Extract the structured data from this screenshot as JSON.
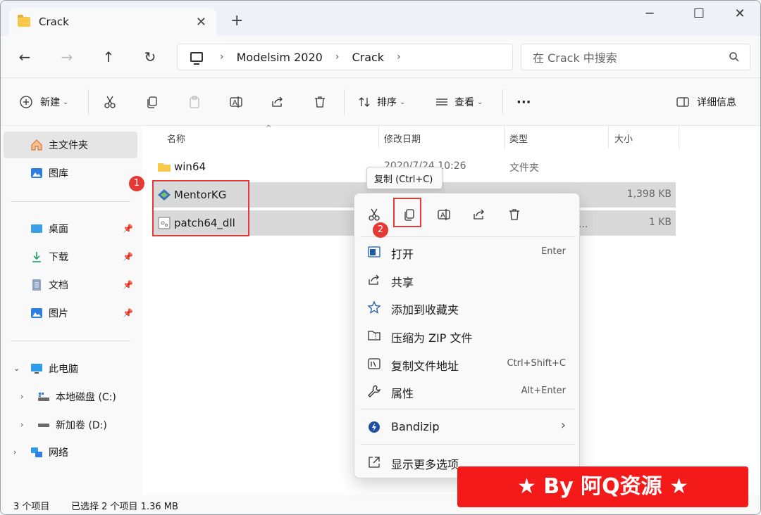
{
  "window": {
    "tab_title": "Crack",
    "tab_close": "✕",
    "new_tab": "+",
    "minimize": "─",
    "maximize": "☐",
    "close": "✕"
  },
  "addressbar": {
    "back": "←",
    "forward": "→",
    "up": "↑",
    "refresh": "↻",
    "crumbs": [
      "Modelsim 2020",
      "Crack"
    ],
    "sep": "›",
    "search_placeholder": "在 Crack 中搜索"
  },
  "toolbar": {
    "new_label": "新建",
    "sort_label": "排序",
    "view_label": "查看",
    "more": "···",
    "details_label": "详细信息",
    "dropdown": "⌄"
  },
  "sidebar": {
    "home": "主文件夹",
    "gallery": "图库",
    "desktop": "桌面",
    "downloads": "下载",
    "documents": "文档",
    "pictures": "图片",
    "this_pc": "此电脑",
    "drive_c": "本地磁盘 (C:)",
    "drive_d": "新加卷 (D:)",
    "network": "网络",
    "pin": "📌",
    "expanded": "⌄",
    "collapsed": "›"
  },
  "columns": {
    "name": "名称",
    "modified": "修改日期",
    "type": "类型",
    "size": "大小",
    "sort_arrow": "^"
  },
  "files": [
    {
      "name": "win64",
      "modified": "2020/7/24 10:26",
      "type": "文件夹",
      "size": ""
    },
    {
      "name": "MentorKG",
      "modified": "",
      "type": "",
      "size": "1,398 KB"
    },
    {
      "name": "patch64_dll",
      "modified": "",
      "type": "理...",
      "size": "1 KB"
    }
  ],
  "status": {
    "count": "3 个项目",
    "selection": "已选择 2 个项目  1.36 MB"
  },
  "annotations": {
    "badge1": "1",
    "badge2": "2"
  },
  "tooltip": "复制 (Ctrl+C)",
  "context_menu": {
    "items": [
      {
        "label": "打开",
        "shortcut": "Enter"
      },
      {
        "label": "共享",
        "shortcut": ""
      },
      {
        "label": "添加到收藏夹",
        "shortcut": ""
      },
      {
        "label": "压缩为 ZIP 文件",
        "shortcut": ""
      },
      {
        "label": "复制文件地址",
        "shortcut": "Ctrl+Shift+C"
      },
      {
        "label": "属性",
        "shortcut": "Alt+Enter"
      }
    ],
    "bandizip": "Bandizip",
    "submenu_arrow": "›",
    "more_options": "显示更多选项"
  },
  "watermark": "★ By 阿Q资源 ★",
  "colors": {
    "accent": "#0067c0",
    "annotation": "#e53935",
    "banner": "#f41a1a",
    "folder": "#f7c94b"
  }
}
